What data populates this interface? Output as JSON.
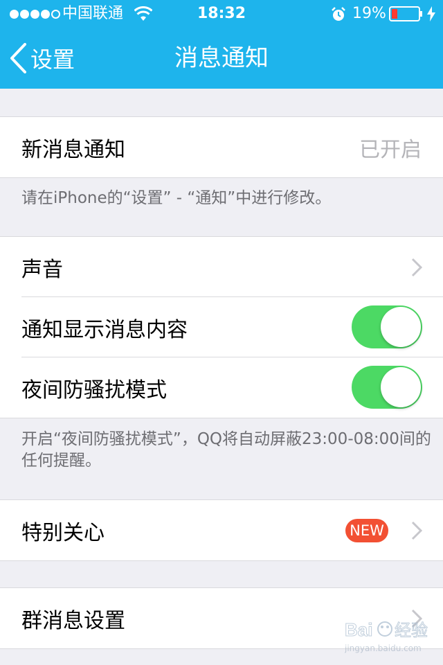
{
  "status_bar": {
    "carrier": "中国联通",
    "time": "18:32",
    "battery": "19%"
  },
  "nav": {
    "back_label": "设置",
    "title": "消息通知"
  },
  "cells": {
    "new_message": {
      "label": "新消息通知",
      "value": "已开启"
    },
    "sound": {
      "label": "声音"
    },
    "show_content": {
      "label": "通知显示消息内容",
      "toggle": true
    },
    "night_mode": {
      "label": "夜间防骚扰模式",
      "toggle": true
    },
    "special_care": {
      "label": "特别关心",
      "badge": "NEW"
    },
    "group_settings": {
      "label": "群消息设置"
    }
  },
  "notes": {
    "notification_hint": "请在iPhone的“设置” - “通知”中进行修改。",
    "night_mode_hint": "开启“夜间防骚扰模式”，QQ将自动屏蔽23:00-08:00间的任何提醒。"
  },
  "watermark": {
    "brand": "Bai 经验",
    "url": "jingyan.baidu.com"
  },
  "colors": {
    "accent": "#1eb4ec",
    "toggle_on": "#4cd964",
    "badge": "#f25033",
    "background": "#efeff4"
  }
}
